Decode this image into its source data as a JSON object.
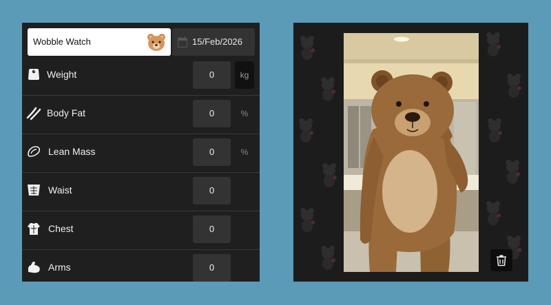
{
  "header": {
    "profile_name": "Wobble Watch",
    "avatar_icon": "bear-face-icon",
    "date": "15/Feb/2026",
    "date_icon": "calendar-icon"
  },
  "metrics": [
    {
      "label": "Weight",
      "value": "0",
      "unit": "kg",
      "icon": "scale-icon"
    },
    {
      "label": "Body Fat",
      "value": "0",
      "unit": "%",
      "icon": "body-fat-icon"
    },
    {
      "label": "Lean Mass",
      "value": "0",
      "unit": "%",
      "icon": "lean-mass-icon"
    },
    {
      "label": "Waist",
      "value": "0",
      "unit": "",
      "icon": "waist-icon"
    },
    {
      "label": "Chest",
      "value": "0",
      "unit": "",
      "icon": "chest-icon"
    },
    {
      "label": "Arms",
      "value": "0",
      "unit": "",
      "icon": "arm-icon"
    }
  ],
  "photo": {
    "subject": "person in teddy bear costume taking mirror selfie",
    "delete_icon": "trash-icon"
  },
  "colors": {
    "background": "#5b9bb8",
    "panel": "#1f1f1f",
    "input": "#333333",
    "bear_fur": "#9a6a3a",
    "bear_belly": "#d4b48a"
  }
}
